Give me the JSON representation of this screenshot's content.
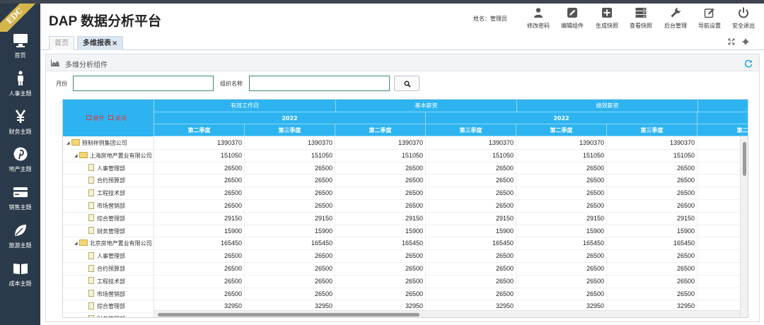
{
  "brand": {
    "ribbon": "EDC"
  },
  "header": {
    "title": "DAP 数据分析平台",
    "user": "姓名：管理员",
    "tools": [
      {
        "label": "修改密码",
        "icon": "user-icon"
      },
      {
        "label": "编辑组件",
        "icon": "edit-icon"
      },
      {
        "label": "生成快照",
        "icon": "plus-square-icon"
      },
      {
        "label": "查看快照",
        "icon": "server-icon"
      },
      {
        "label": "后台管理",
        "icon": "wrench-icon"
      },
      {
        "label": "导航设置",
        "icon": "pencil-square-icon"
      },
      {
        "label": "安全退出",
        "icon": "power-icon"
      }
    ]
  },
  "sidebar": {
    "items": [
      {
        "label": "首页",
        "icon": "monitor-icon"
      },
      {
        "label": "人事主题",
        "icon": "person-icon"
      },
      {
        "label": "财务主题",
        "icon": "yen-icon"
      },
      {
        "label": "地产主题",
        "icon": "pinterest-icon"
      },
      {
        "label": "销售主题",
        "icon": "card-icon"
      },
      {
        "label": "旅游主题",
        "icon": "leaf-icon"
      },
      {
        "label": "成本主题",
        "icon": "book-icon"
      }
    ]
  },
  "tabs": [
    {
      "label": "首页",
      "closable": false
    },
    {
      "label": "多维报表",
      "closable": true,
      "close": "×"
    }
  ],
  "panel": {
    "title": "多维分析组件"
  },
  "filters": {
    "month_label": "月份",
    "org_label": "组织名称",
    "month_value": "",
    "org_value": ""
  },
  "grid": {
    "expand": "展开",
    "collapse": "关闭",
    "measures": [
      "有效工作日",
      "基本薪资",
      "绩效薪资"
    ],
    "years": [
      "2022",
      "2022"
    ],
    "quarters": [
      "第二季度",
      "第三季度",
      "第二季度",
      "第三季度",
      "第二季度",
      "第三季度",
      "第二"
    ],
    "rows": [
      {
        "label": "预制样例集团公司",
        "level": 0,
        "type": "folder",
        "values": [
          "1390370",
          "1390370",
          "1390370",
          "1390370",
          "1390370",
          "1390370"
        ]
      },
      {
        "label": "上海房地产置业有限公司",
        "level": 1,
        "type": "folder",
        "values": [
          "151050",
          "151050",
          "151050",
          "151050",
          "151050",
          "151050"
        ]
      },
      {
        "label": "人事管理部",
        "level": 2,
        "type": "doc",
        "values": [
          "26500",
          "26500",
          "26500",
          "26500",
          "26500",
          "26500"
        ]
      },
      {
        "label": "合约预算部",
        "level": 2,
        "type": "doc",
        "values": [
          "26500",
          "26500",
          "26500",
          "26500",
          "26500",
          "26500"
        ]
      },
      {
        "label": "工程技术部",
        "level": 2,
        "type": "doc",
        "values": [
          "26500",
          "26500",
          "26500",
          "26500",
          "26500",
          "26500"
        ]
      },
      {
        "label": "市场营销部",
        "level": 2,
        "type": "doc",
        "values": [
          "26500",
          "26500",
          "26500",
          "26500",
          "26500",
          "26500"
        ]
      },
      {
        "label": "综合管理部",
        "level": 2,
        "type": "doc",
        "values": [
          "29150",
          "29150",
          "29150",
          "29150",
          "29150",
          "29150"
        ]
      },
      {
        "label": "财务管理部",
        "level": 2,
        "type": "doc",
        "values": [
          "15900",
          "15900",
          "15900",
          "15900",
          "15900",
          "15900"
        ]
      },
      {
        "label": "北京房地产置业有限公司",
        "level": 1,
        "type": "folder",
        "values": [
          "165450",
          "165450",
          "165450",
          "165450",
          "165450",
          "165450"
        ]
      },
      {
        "label": "人事管理部",
        "level": 2,
        "type": "doc",
        "values": [
          "26500",
          "26500",
          "26500",
          "26500",
          "26500",
          "26500"
        ]
      },
      {
        "label": "合约预算部",
        "level": 2,
        "type": "doc",
        "values": [
          "26500",
          "26500",
          "26500",
          "26500",
          "26500",
          "26500"
        ]
      },
      {
        "label": "工程技术部",
        "level": 2,
        "type": "doc",
        "values": [
          "26500",
          "26500",
          "26500",
          "26500",
          "26500",
          "26500"
        ]
      },
      {
        "label": "市场营销部",
        "level": 2,
        "type": "doc",
        "values": [
          "26500",
          "26500",
          "26500",
          "26500",
          "26500",
          "26500"
        ]
      },
      {
        "label": "综合管理部",
        "level": 2,
        "type": "doc",
        "values": [
          "32950",
          "32950",
          "32950",
          "32950",
          "32950",
          "32950"
        ]
      },
      {
        "label": "财务管理部",
        "level": 2,
        "type": "doc",
        "values": [
          "",
          "",
          "",
          "",
          "",
          ""
        ]
      }
    ]
  },
  "colors": {
    "header_blue": "#2db4f0",
    "sidebar": "#2b3a4a",
    "ribbon": "#d3b54c",
    "expand_red": "#e0353b"
  }
}
